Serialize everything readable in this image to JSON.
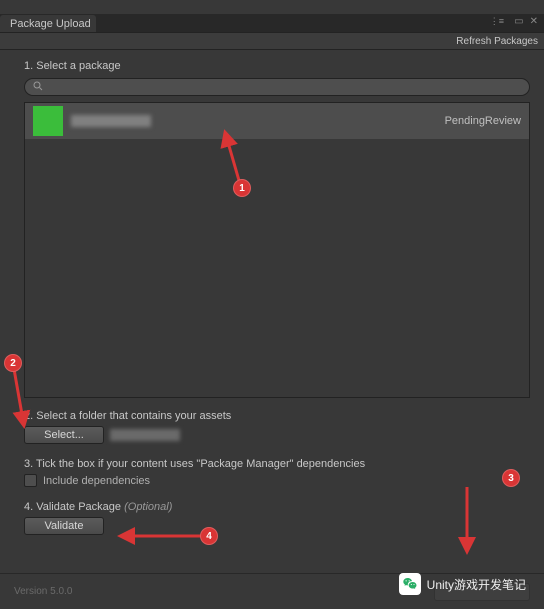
{
  "window": {
    "tab_title": "Package Upload",
    "refresh_label": "Refresh Packages"
  },
  "step1": {
    "label": "1. Select a package",
    "search_placeholder": "",
    "package": {
      "status": "PendingReview"
    }
  },
  "step2": {
    "label": "2. Select a folder that contains your assets",
    "select_button": "Select..."
  },
  "step3": {
    "label": "3. Tick the box if your content uses \"Package Manager\" dependencies",
    "checkbox_label": "Include dependencies"
  },
  "step4": {
    "label_prefix": "4. Validate Package ",
    "label_optional": "(Optional)",
    "validate_button": "Validate"
  },
  "footer": {
    "version": "Version 5.0.0"
  },
  "annotations": {
    "b1": "1",
    "b2": "2",
    "b3": "3",
    "b4": "4"
  },
  "watermark": {
    "text": "Unity游戏开发笔记"
  }
}
